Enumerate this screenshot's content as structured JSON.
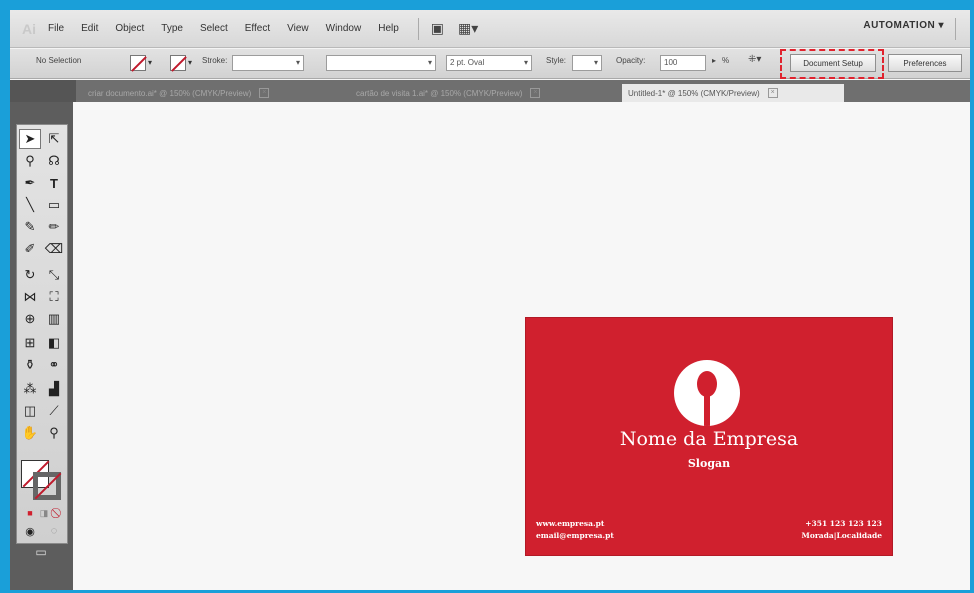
{
  "menu": {
    "items": [
      "File",
      "Edit",
      "Object",
      "Type",
      "Select",
      "Effect",
      "View",
      "Window",
      "Help"
    ],
    "workspace": "AUTOMATION ▾"
  },
  "control": {
    "selection": "No Selection",
    "stroke_label": "Stroke:",
    "brush": "2 pt. Oval",
    "style_label": "Style:",
    "opacity_label": "Opacity:",
    "opacity_value": "100",
    "percent": "%",
    "document_setup": "Document Setup",
    "preferences": "Preferences"
  },
  "tabs": [
    {
      "label": "criar documento.ai* @ 150% (CMYK/Preview)"
    },
    {
      "label": "cartão de visita 1.ai* @ 150% (CMYK/Preview)"
    },
    {
      "label": "Untitled-1* @ 150% (CMYK/Preview)"
    }
  ],
  "card": {
    "company": "Nome da Empresa",
    "slogan": "Slogan",
    "web": "www.empresa.pt",
    "email": "email@empresa.pt",
    "phone": "+351 123 123 123",
    "address": "Morada|Localidade"
  },
  "colors": {
    "accent": "#d0202e",
    "frame": "#1a9fd9",
    "highlight": "#e0232e"
  }
}
